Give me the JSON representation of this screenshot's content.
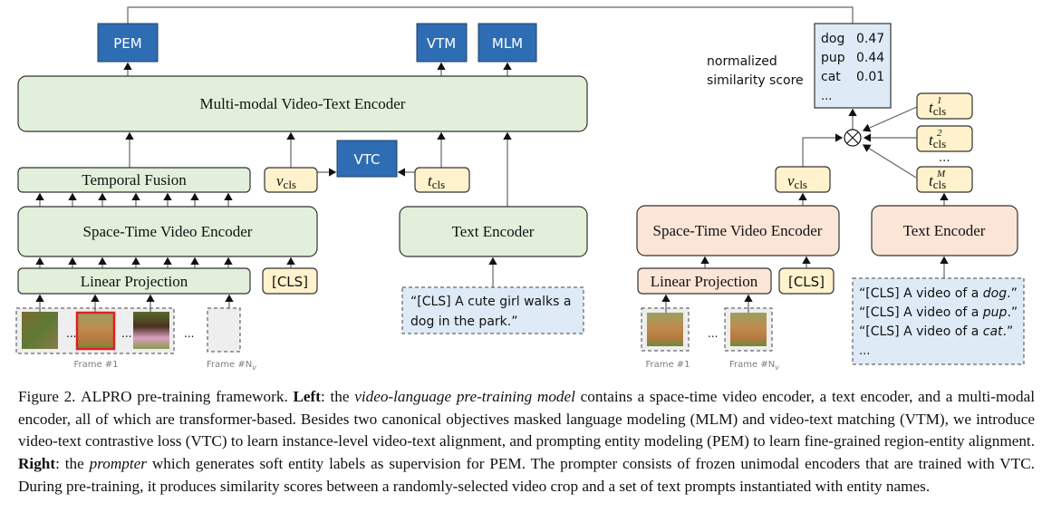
{
  "left": {
    "outputs": {
      "pem": "PEM",
      "vtm": "VTM",
      "mlm": "MLM"
    },
    "multimodal_encoder": "Multi-modal Video-Text Encoder",
    "vtc": "VTC",
    "temporal_fusion": "Temporal Fusion",
    "v_cls": "v",
    "t_cls": "t",
    "cls_sub": "cls",
    "video_encoder": "Space-Time Video Encoder",
    "text_encoder": "Text Encoder",
    "linear_projection": "Linear Projection",
    "cls_token": "[CLS]",
    "text_input": [
      "“[CLS] A cute girl walks a",
      "dog in the park.”"
    ],
    "frame_first": "Frame #1",
    "frame_last": "Frame #N",
    "frame_last_sub": "v",
    "ellipsis": "..."
  },
  "right": {
    "score_label": [
      "normalized",
      "similarity score"
    ],
    "scores": [
      {
        "entity": "dog",
        "score": "0.47"
      },
      {
        "entity": "pup",
        "score": "0.44"
      },
      {
        "entity": "cat",
        "score": "0.01"
      }
    ],
    "scores_more": "...",
    "t_cls_sup": [
      "1",
      "2",
      "M"
    ],
    "video_encoder": "Space-Time Video Encoder",
    "text_encoder": "Text Encoder",
    "linear_projection": "Linear Projection",
    "cls_token": "[CLS]",
    "prompts": [
      {
        "pre": "“[CLS] A video of a ",
        "entity": "dog",
        "post": ".”"
      },
      {
        "pre": "“[CLS] A video of a ",
        "entity": "pup",
        "post": ".”"
      },
      {
        "pre": "“[CLS] A video of a ",
        "entity": "cat",
        "post": ".”"
      }
    ],
    "prompts_more": "...",
    "frame_first": "Frame #1",
    "frame_last": "Frame #N",
    "frame_last_sub": "v"
  },
  "colors": {
    "objective_blue": "#2e6db4",
    "green": "#e2efda",
    "peach": "#fbe5d6",
    "yellow": "#fff2cc",
    "text_blue": "#deebf7",
    "crop_red": "#e02020"
  },
  "caption": {
    "label": "Figure 2.",
    "name": "ALPRO",
    "s1": " pre-training framework. ",
    "left": "Left",
    "s2": ": the ",
    "model": "video-language pre-training model",
    "s3": " contains a space-time video encoder, a text encoder, and a multi-modal encoder, all of which are transformer-based. Besides two canonical objectives masked language modeling (MLM) and video-text matching (VTM), we introduce video-text contrastive loss (VTC) to learn instance-level video-text alignment, and prompting entity modeling (PEM) to learn fine-grained region-entity alignment. ",
    "right": "Right",
    "s4": ": the ",
    "prompter": "prompter",
    "s5": " which generates soft entity labels as supervision for PEM. The prompter consists of frozen unimodal encoders that are trained with VTC. During pre-training, it produces similarity scores between a randomly-selected video crop and a set of text prompts instantiated with entity names."
  }
}
